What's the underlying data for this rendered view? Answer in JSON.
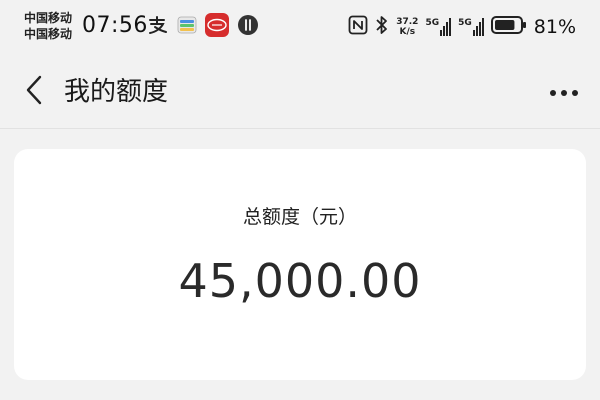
{
  "status_bar": {
    "carrier_1": "中国移动",
    "carrier_2": "中国移动",
    "time": "07:56",
    "net_speed_value": "37.2",
    "net_speed_unit": "K/s",
    "signal_1_label": "5G",
    "signal_2_label": "5G",
    "battery_percent": "81%",
    "battery_level": 0.81,
    "icons_left": [
      "alipay-icon",
      "wallet-card-icon",
      "byd-app-icon",
      "notification-badge-icon"
    ],
    "icons_right": [
      "nfc-icon",
      "bluetooth-icon",
      "network-speed",
      "signal-5g-icon",
      "signal-5g-icon",
      "battery-icon"
    ]
  },
  "nav": {
    "title": "我的额度",
    "back_icon": "chevron-left-icon",
    "more_icon": "more-horizontal-icon"
  },
  "card": {
    "label": "总额度（元）",
    "amount": "45,000.00"
  },
  "colors": {
    "background": "#f2f2f2",
    "card": "#ffffff",
    "text": "#1a1a1a",
    "byd_red": "#d62d2d"
  }
}
